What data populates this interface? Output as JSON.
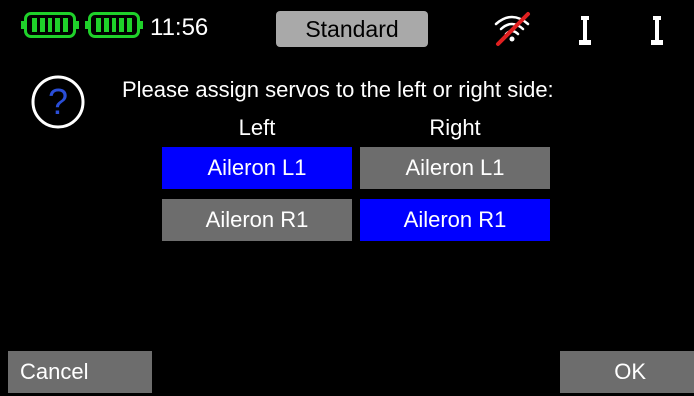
{
  "status_bar": {
    "time": "11:56",
    "model_name": "Standard",
    "battery_icons": [
      "battery-full-icon",
      "battery-full-icon"
    ],
    "signal_icon": "no-signal-icon",
    "antenna_icons": [
      "antenna-icon",
      "antenna-icon"
    ],
    "colors": {
      "battery": "#1fd12a",
      "signal_strike": "#e02020",
      "pill": "#a9a9a9"
    }
  },
  "dialog": {
    "icon": "question-icon",
    "prompt": "Please assign servos to the left or right side:",
    "columns": {
      "left": "Left",
      "right": "Right"
    },
    "rows": [
      {
        "left": "Aileron L1",
        "left_selected": true,
        "right": "Aileron L1",
        "right_selected": false
      },
      {
        "left": "Aileron R1",
        "left_selected": false,
        "right": "Aileron R1",
        "right_selected": true
      }
    ],
    "colors": {
      "selected": "#0000ff",
      "unselected": "#6d6d6d"
    }
  },
  "softkeys": {
    "cancel": "Cancel",
    "ok": "OK"
  }
}
